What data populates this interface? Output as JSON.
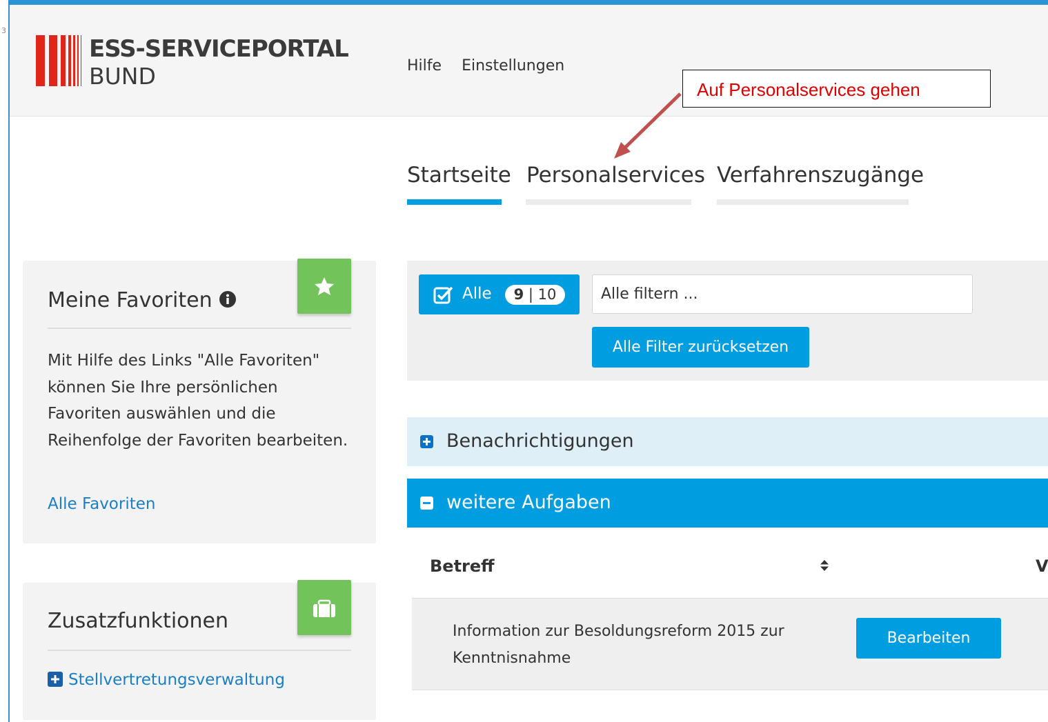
{
  "frame": {
    "tick": "3"
  },
  "brand": {
    "name_line1": "ESS-SERVICEPORTAL",
    "name_line2": "BUND",
    "bar_color": "#e0261b"
  },
  "top_nav": {
    "items": [
      "Hilfe",
      "Einstellungen"
    ]
  },
  "annotation": {
    "text": "Auf Personalservices gehen",
    "text_color": "#e00000",
    "arrow_color": "#c0504d"
  },
  "tabs": [
    {
      "label": "Startseite",
      "active": true
    },
    {
      "label": "Personalservices",
      "active": false
    },
    {
      "label": "Verfahrenszugänge",
      "active": false
    }
  ],
  "favorites": {
    "title": "Meine Favoriten",
    "icon": "star-icon",
    "info_icon": "info-icon",
    "description": "Mit Hilfe des Links \"Alle Favoriten\" können Sie Ihre persönlichen Favoriten auswählen und die Reihenfolge der Favoriten bearbeiten.",
    "link": "Alle Favoriten"
  },
  "extras": {
    "title": "Zusatzfunktionen",
    "icon": "briefcase-icon",
    "link": "Stellvertretungsverwaltung"
  },
  "filter": {
    "all_label": "Alle",
    "count_bold": "9",
    "count_sep": " | ",
    "count_total": "10",
    "input_value": "Alle filtern ...",
    "reset_label": "Alle Filter zurücksetzen"
  },
  "sections": [
    {
      "label": "Benachrichtigungen",
      "expanded": false
    },
    {
      "label": "weitere Aufgaben",
      "expanded": true
    }
  ],
  "table": {
    "columns": [
      "Betreff",
      "V"
    ],
    "rows": [
      {
        "subject": "Information zur Besoldungsreform 2015 zur Kenntnisnahme",
        "action": "Bearbeiten"
      }
    ]
  },
  "colors": {
    "primary": "#009de0",
    "accent_green": "#72c35a",
    "link": "#1a7fc7",
    "collapsed_bg": "#dfeff7"
  }
}
